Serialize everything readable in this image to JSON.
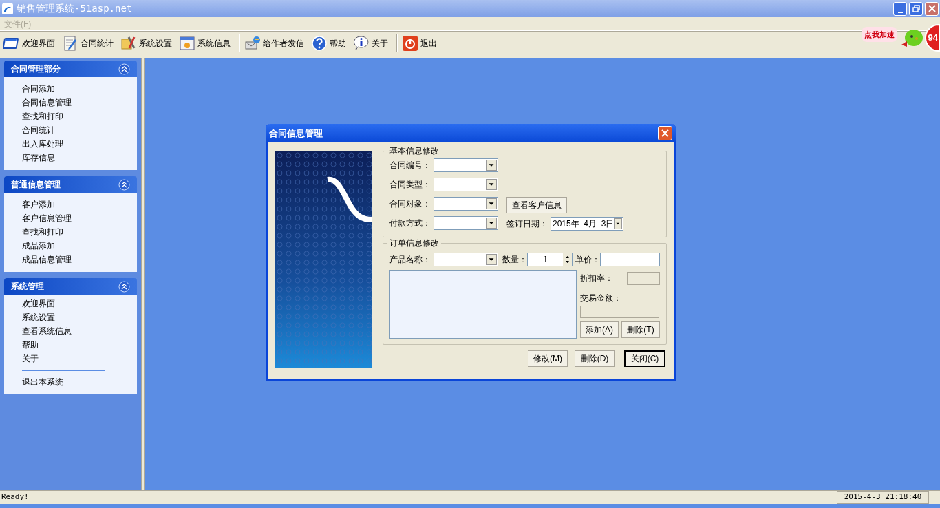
{
  "window": {
    "title": "销售管理系统-51asp.net"
  },
  "menu": [
    {
      "label": "文件(F)",
      "disabled": true
    }
  ],
  "toolbar": [
    {
      "label": "欢迎界面",
      "separator_before": false
    },
    {
      "label": "合同统计",
      "separator_before": false
    },
    {
      "label": "系统设置",
      "separator_before": false
    },
    {
      "label": "系统信息",
      "separator_before": false
    },
    {
      "label": "给作者发信",
      "separator_before": true
    },
    {
      "label": "帮助",
      "separator_before": false
    },
    {
      "label": "关于",
      "separator_before": false
    },
    {
      "label": "退出",
      "separator_before": true
    }
  ],
  "speed_badge": {
    "label": "点我加速",
    "value": "94"
  },
  "sidebar": [
    {
      "title": "合同管理部分",
      "expanded": true,
      "items": [
        {
          "kind": "item",
          "label": "合同添加"
        },
        {
          "kind": "item",
          "label": "合同信息管理"
        },
        {
          "kind": "item",
          "label": "查找和打印"
        },
        {
          "kind": "item",
          "label": "合同统计"
        },
        {
          "kind": "item",
          "label": "出入库处理"
        },
        {
          "kind": "item",
          "label": "库存信息"
        }
      ]
    },
    {
      "title": "普通信息管理",
      "expanded": true,
      "items": [
        {
          "kind": "item",
          "label": "客户添加"
        },
        {
          "kind": "item",
          "label": "客户信息管理"
        },
        {
          "kind": "item",
          "label": "查找和打印"
        },
        {
          "kind": "item",
          "label": "成品添加"
        },
        {
          "kind": "item",
          "label": "成品信息管理"
        }
      ]
    },
    {
      "title": "系统管理",
      "expanded": true,
      "items": [
        {
          "kind": "item",
          "label": "欢迎界面"
        },
        {
          "kind": "item",
          "label": "系统设置"
        },
        {
          "kind": "item",
          "label": "查看系统信息"
        },
        {
          "kind": "item",
          "label": "帮助"
        },
        {
          "kind": "item",
          "label": "关于"
        },
        {
          "kind": "divider"
        },
        {
          "kind": "item",
          "label": "退出本系统"
        }
      ]
    }
  ],
  "dialog": {
    "title": "合同信息管理",
    "basic": {
      "title": "基本信息修改",
      "fields": [
        {
          "label": "合同编号："
        },
        {
          "label": "合同类型："
        },
        {
          "label": "合同对象："
        },
        {
          "label": "付款方式："
        }
      ],
      "customer_button": "查看客户信息",
      "date_label": "签订日期：",
      "date_value": "2015年  4月  3日"
    },
    "order": {
      "title": "订单信息修改",
      "product_label": "产品名称：",
      "quantity_label": "数量：",
      "quantity_value": "1",
      "price_label": "单价：",
      "discount_label": "折扣率：",
      "amount_label": "交易金额：",
      "add_button": "添加(A)",
      "remove_button": "删除(T)"
    },
    "buttons": [
      {
        "label": "修改(M)",
        "default": false
      },
      {
        "label": "删除(D)",
        "default": false
      },
      {
        "label": "关闭(C)",
        "default": true
      }
    ]
  },
  "status_bar": {
    "message": "Ready!",
    "datetime": "2015-4-3 21:18:40"
  }
}
